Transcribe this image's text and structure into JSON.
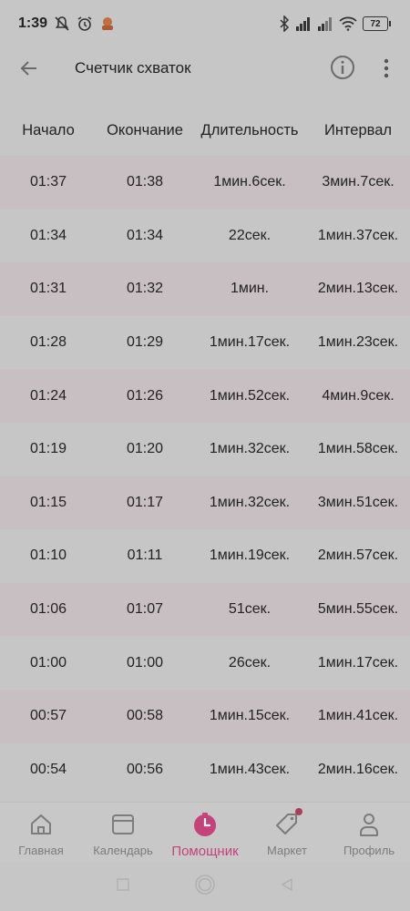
{
  "status_bar": {
    "time": "1:39",
    "battery": "72"
  },
  "app_bar": {
    "title": "Счетчик схваток"
  },
  "table": {
    "headers": [
      "Начало",
      "Окончание",
      "Длительность",
      "Интервал"
    ],
    "rows": [
      [
        "01:37",
        "01:38",
        "1мин.6сек.",
        "3мин.7сек."
      ],
      [
        "01:34",
        "01:34",
        "22сек.",
        "1мин.37сек."
      ],
      [
        "01:31",
        "01:32",
        "1мин.",
        "2мин.13сек."
      ],
      [
        "01:28",
        "01:29",
        "1мин.17сек.",
        "1мин.23сек."
      ],
      [
        "01:24",
        "01:26",
        "1мин.52сек.",
        "4мин.9сек."
      ],
      [
        "01:19",
        "01:20",
        "1мин.32сек.",
        "1мин.58сек."
      ],
      [
        "01:15",
        "01:17",
        "1мин.32сек.",
        "3мин.51сек."
      ],
      [
        "01:10",
        "01:11",
        "1мин.19сек.",
        "2мин.57сек."
      ],
      [
        "01:06",
        "01:07",
        "51сек.",
        "5мин.55сек."
      ],
      [
        "01:00",
        "01:00",
        "26сек.",
        "1мин.17сек."
      ],
      [
        "00:57",
        "00:58",
        "1мин.15сек.",
        "1мин.41сек."
      ],
      [
        "00:54",
        "00:56",
        "1мин.43сек.",
        "2мин.16сек."
      ]
    ]
  },
  "bottom_nav": [
    {
      "label": "Главная",
      "icon": "home-icon"
    },
    {
      "label": "Календарь",
      "icon": "calendar-icon"
    },
    {
      "label": "Помощник",
      "icon": "timer-icon",
      "active": true
    },
    {
      "label": "Маркет",
      "icon": "tag-icon",
      "badge": true
    },
    {
      "label": "Профиль",
      "icon": "person-icon"
    }
  ],
  "colors": {
    "accent": "#c5427a",
    "background": "#c6c6c6",
    "row_shade": "#c8bfc2",
    "inactive": "#7c7c7c"
  }
}
